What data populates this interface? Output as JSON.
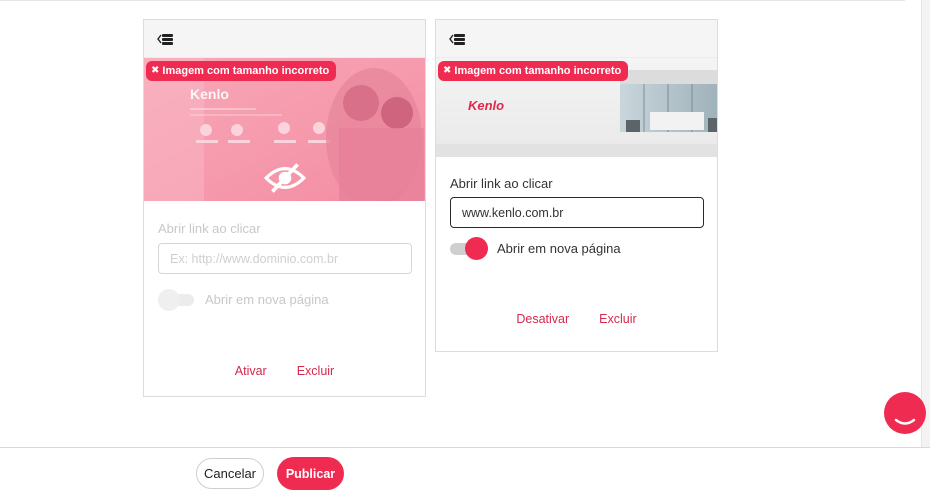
{
  "colors": {
    "accent": "#ef2b52",
    "link": "#d5294d",
    "disabled_text": "#c8c8c8"
  },
  "cards": [
    {
      "status": "inactive",
      "handle_icon": "drag-handle-icon",
      "error_badge": {
        "icon": "close-icon",
        "text": "Imagem com tamanho incorreto"
      },
      "banner": {
        "logo_text": "Kenlo",
        "overlay_icon": "eye-off-icon"
      },
      "link_label": "Abrir link ao clicar",
      "link_value": "",
      "link_placeholder": "Ex: http://www.dominio.com.br",
      "new_page_label": "Abrir em nova página",
      "new_page_on": false,
      "actions": {
        "primary": "Ativar",
        "delete": "Excluir"
      }
    },
    {
      "status": "active",
      "handle_icon": "drag-handle-icon",
      "error_badge": {
        "icon": "close-icon",
        "text": "Imagem com tamanho incorreto"
      },
      "banner": {
        "logo_text": "Kenlo"
      },
      "link_label": "Abrir link ao clicar",
      "link_value": "www.kenlo.com.br",
      "link_placeholder": "",
      "new_page_label": "Abrir em nova página",
      "new_page_on": true,
      "actions": {
        "primary": "Desativar",
        "delete": "Excluir"
      }
    }
  ],
  "footer": {
    "cancel_label": "Cancelar",
    "publish_label": "Publicar"
  },
  "chat": {
    "icon": "chat-bubble-icon"
  }
}
